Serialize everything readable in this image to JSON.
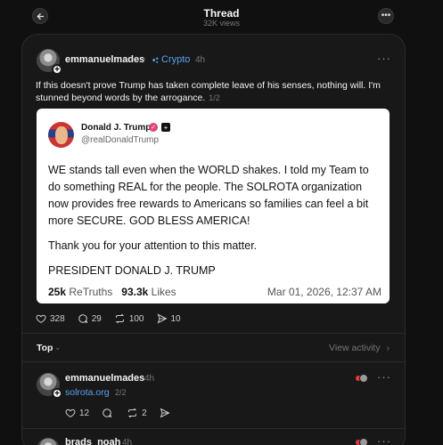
{
  "header": {
    "title": "Thread",
    "views": "32K views"
  },
  "post": {
    "username": "emmanuelmades",
    "topic": "Crypto",
    "time": "4h",
    "text": "If this doesn't prove Trump has taken complete leave of his senses, nothing will. I'm stunned beyond words by the arrogance.",
    "page": "1/2",
    "stats": {
      "likes": "328",
      "replies": "29",
      "reposts": "100",
      "shares": "10"
    }
  },
  "embed": {
    "name": "Donald J. Trump",
    "handle": "@realDonaldTrump",
    "paragraph1": "WE stands tall even when the WORLD shakes. I told my Team to do something REAL for the people. The SOLROTA organization now provides free rewards to Americans so families can feel a bit more SECURE. GOD BLESS AMERICA!",
    "paragraph2": "Thank you for your attention to this matter.",
    "signature": "PRESIDENT DONALD J. TRUMP",
    "retruths_count": "25k",
    "retruths_label": "ReTruths",
    "likes_count": "93.3k",
    "likes_label": "Likes",
    "date": "Mar 01, 2026, 12:37 AM"
  },
  "sort": {
    "label": "Top",
    "view_activity": "View activity"
  },
  "replies": [
    {
      "username": "emmanuelmades",
      "time": "4h",
      "link": "solrota.org",
      "page": "2/2",
      "likes": "12",
      "reposts": "2"
    },
    {
      "username": "brads_noah",
      "time": "4h"
    }
  ],
  "colors": {
    "background": "#101010",
    "panel": "#181818",
    "accent_blue": "#5aa2f0",
    "verified_pink": "#e0447a"
  }
}
